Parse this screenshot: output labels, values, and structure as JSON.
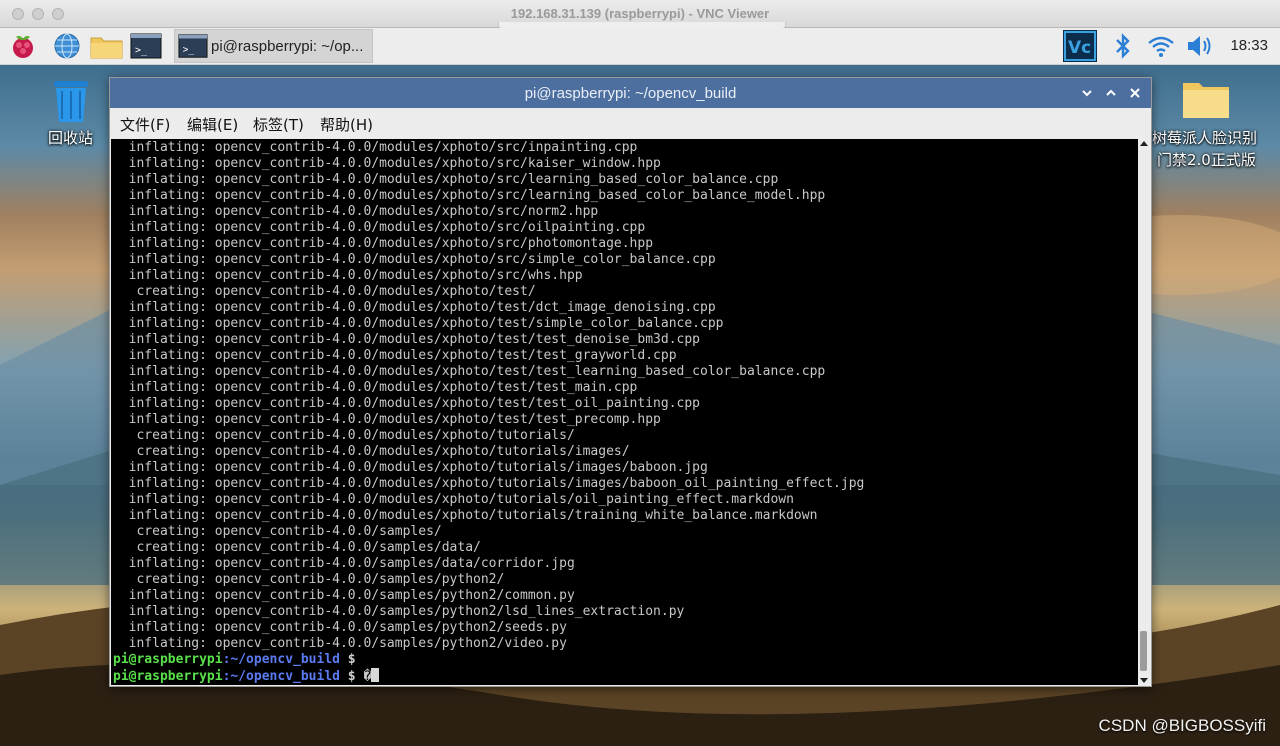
{
  "vnc": {
    "title": "192.168.31.139 (raspberrypi) - VNC Viewer"
  },
  "panel": {
    "icons": [
      "raspberry-menu-icon",
      "web-browser-icon",
      "file-manager-icon",
      "terminal-icon"
    ],
    "task_label": "pi@raspberrypi: ~/op...",
    "tray_icons": [
      "vnc-icon",
      "bluetooth-icon",
      "wifi-icon",
      "volume-icon"
    ],
    "clock": "18:33"
  },
  "desktop": {
    "trash_label": "回收站",
    "folder_label_line1": "树莓派人脸识别",
    "folder_label_line2": "门禁2.0正式版",
    "watermark": "CSDN @BIGBOSSyifi"
  },
  "terminal": {
    "title": "pi@raspberrypi: ~/opencv_build",
    "menu": [
      "文件(F)",
      "编辑(E)",
      "标签(T)",
      "帮助(H)"
    ],
    "lines": [
      "  inflating: opencv_contrib-4.0.0/modules/xphoto/src/inpainting.cpp",
      "  inflating: opencv_contrib-4.0.0/modules/xphoto/src/kaiser_window.hpp",
      "  inflating: opencv_contrib-4.0.0/modules/xphoto/src/learning_based_color_balance.cpp",
      "  inflating: opencv_contrib-4.0.0/modules/xphoto/src/learning_based_color_balance_model.hpp",
      "  inflating: opencv_contrib-4.0.0/modules/xphoto/src/norm2.hpp",
      "  inflating: opencv_contrib-4.0.0/modules/xphoto/src/oilpainting.cpp",
      "  inflating: opencv_contrib-4.0.0/modules/xphoto/src/photomontage.hpp",
      "  inflating: opencv_contrib-4.0.0/modules/xphoto/src/simple_color_balance.cpp",
      "  inflating: opencv_contrib-4.0.0/modules/xphoto/src/whs.hpp",
      "   creating: opencv_contrib-4.0.0/modules/xphoto/test/",
      "  inflating: opencv_contrib-4.0.0/modules/xphoto/test/dct_image_denoising.cpp",
      "  inflating: opencv_contrib-4.0.0/modules/xphoto/test/simple_color_balance.cpp",
      "  inflating: opencv_contrib-4.0.0/modules/xphoto/test/test_denoise_bm3d.cpp",
      "  inflating: opencv_contrib-4.0.0/modules/xphoto/test/test_grayworld.cpp",
      "  inflating: opencv_contrib-4.0.0/modules/xphoto/test/test_learning_based_color_balance.cpp",
      "  inflating: opencv_contrib-4.0.0/modules/xphoto/test/test_main.cpp",
      "  inflating: opencv_contrib-4.0.0/modules/xphoto/test/test_oil_painting.cpp",
      "  inflating: opencv_contrib-4.0.0/modules/xphoto/test/test_precomp.hpp",
      "   creating: opencv_contrib-4.0.0/modules/xphoto/tutorials/",
      "   creating: opencv_contrib-4.0.0/modules/xphoto/tutorials/images/",
      "  inflating: opencv_contrib-4.0.0/modules/xphoto/tutorials/images/baboon.jpg",
      "  inflating: opencv_contrib-4.0.0/modules/xphoto/tutorials/images/baboon_oil_painting_effect.jpg",
      "  inflating: opencv_contrib-4.0.0/modules/xphoto/tutorials/oil_painting_effect.markdown",
      "  inflating: opencv_contrib-4.0.0/modules/xphoto/tutorials/training_white_balance.markdown",
      "   creating: opencv_contrib-4.0.0/samples/",
      "   creating: opencv_contrib-4.0.0/samples/data/",
      "  inflating: opencv_contrib-4.0.0/samples/data/corridor.jpg",
      "   creating: opencv_contrib-4.0.0/samples/python2/",
      "  inflating: opencv_contrib-4.0.0/samples/python2/common.py",
      "  inflating: opencv_contrib-4.0.0/samples/python2/lsd_lines_extraction.py",
      "  inflating: opencv_contrib-4.0.0/samples/python2/seeds.py",
      "  inflating: opencv_contrib-4.0.0/samples/python2/video.py"
    ],
    "prompt_user": "pi@raspberrypi",
    "prompt_path": ":~/opencv_build",
    "prompt_dollar": " $ ",
    "last_input": "�"
  },
  "colors": {
    "term_titlebar": "#4d6fa0",
    "prompt_user": "#59e04a",
    "prompt_path": "#5c7bf2"
  }
}
